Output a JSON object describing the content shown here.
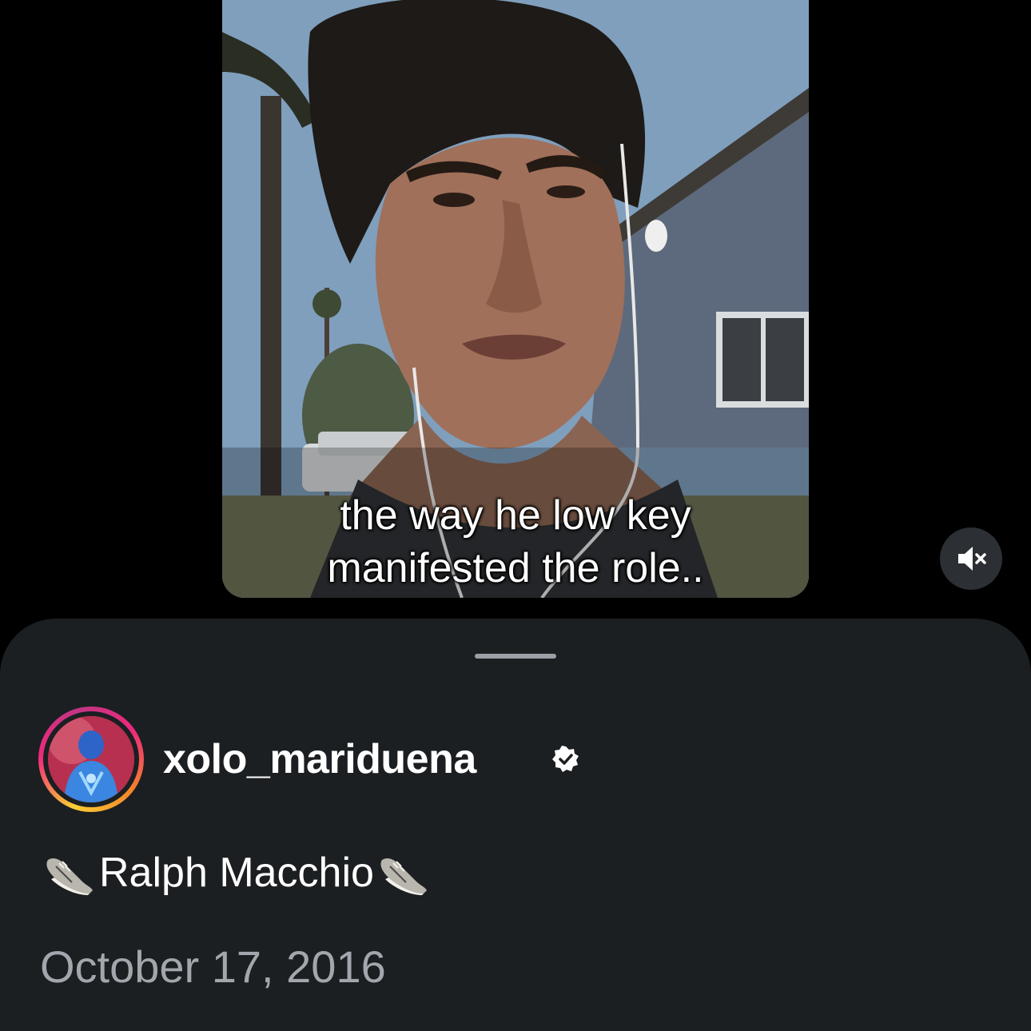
{
  "video": {
    "caption_line1": "the way he low key",
    "caption_line2": "manifested the role..",
    "mute_icon": "speaker-muted-icon"
  },
  "post": {
    "username": "xolo_mariduena",
    "verified_icon": "verified-badge-icon",
    "caption_text": "Ralph Macchio",
    "caption_emoji": "athletic-shoe-emoji",
    "date": "October 17, 2016"
  },
  "colors": {
    "background": "#000000",
    "sheet": "#1b1f22",
    "text_primary": "#ffffff",
    "text_secondary": "#a2a7ad",
    "story_ring_start": "#f9ce34",
    "story_ring_mid": "#ee2a7b",
    "story_ring_end": "#c13584"
  }
}
